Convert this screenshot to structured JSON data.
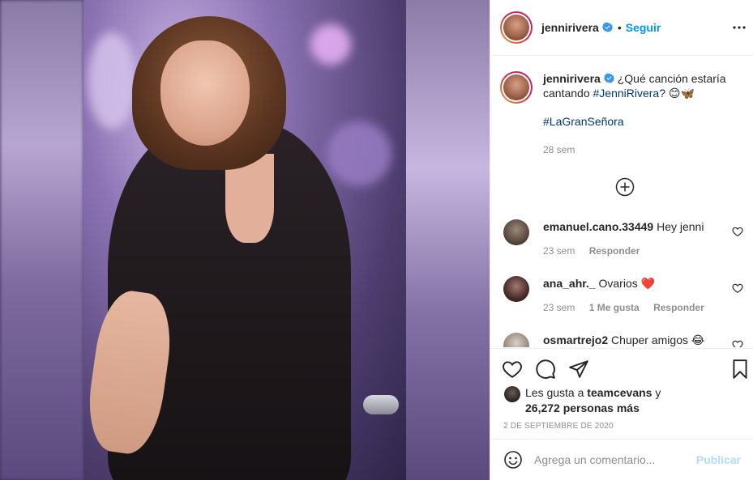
{
  "post": {
    "username": "jennirivera",
    "verified": true,
    "follow_label": "Seguir",
    "separator": "•",
    "more_icon": "more-horizontal-icon"
  },
  "caption": {
    "username": "jennirivera",
    "text_part1": "¿Qué canción estaría cantando ",
    "hashtag1": "#JenniRivera",
    "text_part2": "? 😊🦋",
    "hashtag2": "#LaGranSeñora",
    "time": "28 sem"
  },
  "comments": [
    {
      "username": "emanuel.cano.33449",
      "text": " Hey jenni",
      "time": "23 sem",
      "likes": "",
      "reply": "Responder"
    },
    {
      "username": "ana_ahr._",
      "text": " Ovarios ❤️",
      "time": "23 sem",
      "likes": "1 Me gusta",
      "reply": "Responder"
    },
    {
      "username": "osmartrejo2",
      "text": " Chuper amigos 😂",
      "time": "",
      "likes": "",
      "reply": ""
    }
  ],
  "likes": {
    "prefix": "Les gusta a ",
    "user": "teamcevans",
    "middle": " y",
    "count": "26,272 personas más"
  },
  "date": "2 DE SEPTIEMBRE DE 2020",
  "add_comment": {
    "placeholder": "Agrega un comentario...",
    "post_label": "Publicar"
  },
  "colors": {
    "link_blue": "#0095f6",
    "hashtag": "#00376b",
    "muted": "#8e8e8e",
    "publish_disabled": "#b3dbff",
    "heart_red": "#ed4956"
  }
}
